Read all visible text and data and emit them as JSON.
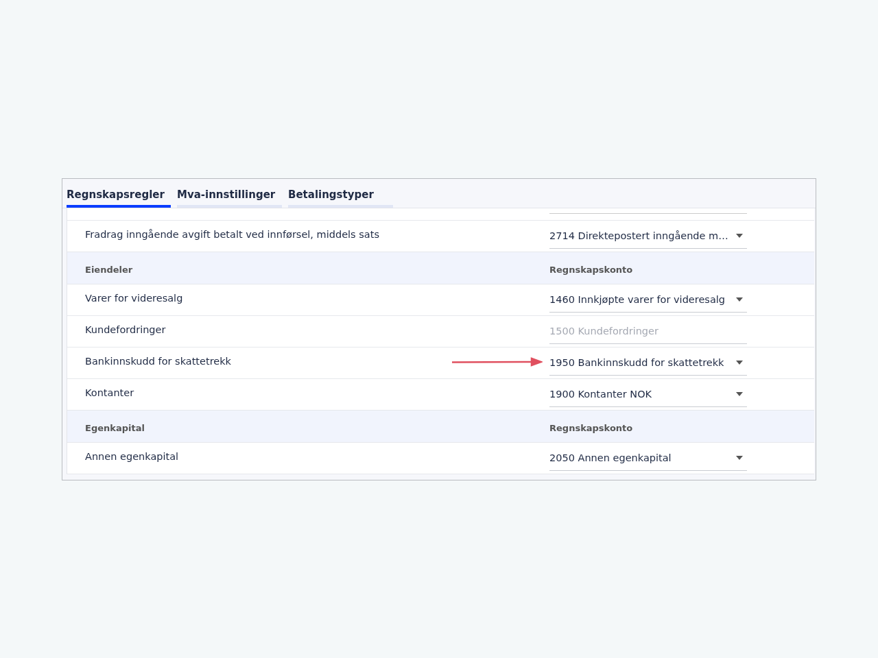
{
  "tabs": [
    {
      "label": "Regnskapsregler",
      "selected": true
    },
    {
      "label": "Mva-innstillinger",
      "selected": false
    },
    {
      "label": "Betalingstyper",
      "selected": false
    }
  ],
  "rows": [
    {
      "kind": "row",
      "label": "Fradrag inngående avgift betalt ved innførsel, middels sats",
      "account": "2714 Direktepostert inngående m…",
      "disabled": false,
      "arrow": false
    },
    {
      "kind": "section",
      "label": "Eiendeler",
      "column_heading": "Regnskapskonto"
    },
    {
      "kind": "row",
      "label": "Varer for videresalg",
      "account": "1460 Innkjøpte varer for videresalg",
      "disabled": false,
      "arrow": false
    },
    {
      "kind": "row",
      "label": "Kundefordringer",
      "account": "1500 Kundefordringer",
      "disabled": true,
      "arrow": false
    },
    {
      "kind": "row",
      "label": "Bankinnskudd for skattetrekk",
      "account": "1950 Bankinnskudd for skattetrekk",
      "disabled": false,
      "arrow": true
    },
    {
      "kind": "row",
      "label": "Kontanter",
      "account": "1900 Kontanter NOK",
      "disabled": false,
      "arrow": false
    },
    {
      "kind": "section",
      "label": "Egenkapital",
      "column_heading": "Regnskapskonto"
    },
    {
      "kind": "row",
      "label": "Annen egenkapital",
      "account": "2050 Annen egenkapital",
      "disabled": false,
      "arrow": false
    }
  ]
}
